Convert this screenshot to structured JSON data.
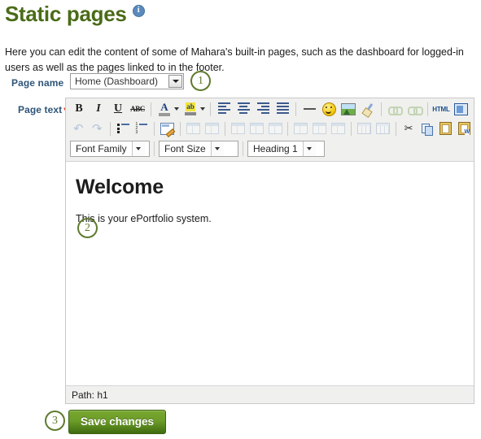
{
  "page": {
    "title": "Static pages",
    "info_icon": "info-icon",
    "intro": "Here you can edit the content of some of Mahara's built-in pages, such as the dashboard for logged-in users as well as the pages linked to in the footer."
  },
  "form": {
    "page_name": {
      "label": "Page name",
      "value": "Home (Dashboard)",
      "options": [
        "Home (Dashboard)"
      ]
    },
    "page_text": {
      "label": "Page text",
      "required_marker": "*"
    }
  },
  "annotations": [
    {
      "number": "1"
    },
    {
      "number": "2"
    },
    {
      "number": "3"
    }
  ],
  "editor": {
    "toolbar_row1": [
      {
        "name": "bold-icon",
        "label": "B",
        "enabled": true
      },
      {
        "name": "italic-icon",
        "label": "I",
        "enabled": true
      },
      {
        "name": "underline-icon",
        "label": "U",
        "enabled": true
      },
      {
        "name": "strikethrough-icon",
        "label": "ABC",
        "enabled": true
      },
      {
        "name": "text-color-icon",
        "label": "A",
        "enabled": true
      },
      {
        "name": "background-color-icon",
        "label": "ab",
        "enabled": true
      },
      {
        "name": "align-left-icon",
        "label": "",
        "enabled": true
      },
      {
        "name": "align-center-icon",
        "label": "",
        "enabled": true
      },
      {
        "name": "align-right-icon",
        "label": "",
        "enabled": true
      },
      {
        "name": "align-justify-icon",
        "label": "",
        "enabled": true
      },
      {
        "name": "horizontal-rule-icon",
        "label": "",
        "enabled": true
      },
      {
        "name": "emoticon-icon",
        "label": "",
        "enabled": true
      },
      {
        "name": "insert-image-icon",
        "label": "",
        "enabled": true
      },
      {
        "name": "cleanup-icon",
        "label": "",
        "enabled": true
      },
      {
        "name": "insert-link-icon",
        "label": "",
        "enabled": false
      },
      {
        "name": "unlink-icon",
        "label": "",
        "enabled": false
      },
      {
        "name": "html-source-icon",
        "label": "HTML",
        "enabled": true
      },
      {
        "name": "fullscreen-icon",
        "label": "",
        "enabled": true
      }
    ],
    "toolbar_row2": [
      {
        "name": "undo-icon",
        "enabled": false
      },
      {
        "name": "redo-icon",
        "enabled": false
      },
      {
        "name": "bullet-list-icon",
        "enabled": true
      },
      {
        "name": "numbered-list-icon",
        "enabled": true
      },
      {
        "name": "edit-document-icon",
        "enabled": true
      },
      {
        "name": "table-properties-icon",
        "enabled": false
      },
      {
        "name": "cell-properties-icon",
        "enabled": false
      },
      {
        "name": "insert-row-before-icon",
        "enabled": false
      },
      {
        "name": "insert-row-after-icon",
        "enabled": false
      },
      {
        "name": "delete-row-icon",
        "enabled": false
      },
      {
        "name": "insert-column-before-icon",
        "enabled": false
      },
      {
        "name": "insert-column-after-icon",
        "enabled": false
      },
      {
        "name": "delete-column-icon",
        "enabled": false
      },
      {
        "name": "split-cells-icon",
        "enabled": false
      },
      {
        "name": "merge-cells-icon",
        "enabled": false
      },
      {
        "name": "cut-icon",
        "enabled": true
      },
      {
        "name": "copy-icon",
        "enabled": true
      },
      {
        "name": "paste-icon",
        "enabled": true
      },
      {
        "name": "paste-from-word-icon",
        "enabled": true
      }
    ],
    "selects": {
      "font_family": "Font Family",
      "font_size": "Font Size",
      "format": "Heading 1"
    },
    "content": {
      "heading": "Welcome",
      "paragraph": "This is your ePortfolio system."
    },
    "status_bar": "Path: h1"
  },
  "actions": {
    "save_label": "Save changes"
  },
  "colors": {
    "title": "#4a6b18",
    "label": "#2f5579",
    "annotation": "#5f7a2e",
    "required": "#cc2200",
    "save_button": "#6d9d29"
  }
}
